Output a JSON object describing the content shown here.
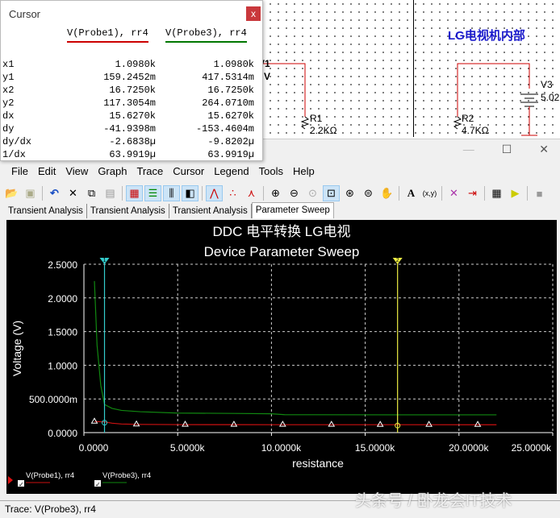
{
  "schematic": {
    "label_title": "LG电视机内部",
    "v1": "V1",
    "v1_val": "V",
    "r1": "R1",
    "r1_val": "2.2KΩ",
    "r2": "R2",
    "r2_val": "4.7KΩ",
    "v3": "V3",
    "v3_val": "5.02"
  },
  "cursor_window": {
    "title": "Cursor",
    "close": "x",
    "columns": [
      "V(Probe1), rr4",
      "V(Probe3), rr4"
    ],
    "col_colors": [
      "#cc0000",
      "#007700"
    ],
    "rows": [
      {
        "label": "x1",
        "v": [
          "1.0980k",
          "1.0980k"
        ]
      },
      {
        "label": "y1",
        "v": [
          "159.2452m",
          "417.5314m"
        ]
      },
      {
        "label": "x2",
        "v": [
          "16.7250k",
          "16.7250k"
        ]
      },
      {
        "label": "y2",
        "v": [
          "117.3054m",
          "264.0710m"
        ]
      },
      {
        "label": "dx",
        "v": [
          "15.6270k",
          "15.6270k"
        ]
      },
      {
        "label": "dy",
        "v": [
          "-41.9398m",
          "-153.4604m"
        ]
      },
      {
        "label": "dy/dx",
        "v": [
          "-2.6838µ",
          "-9.8202µ"
        ]
      },
      {
        "label": "1/dx",
        "v": [
          "63.9919µ",
          "63.9919µ"
        ]
      }
    ]
  },
  "grapher": {
    "menu": [
      "File",
      "Edit",
      "View",
      "Graph",
      "Trace",
      "Cursor",
      "Legend",
      "Tools",
      "Help"
    ],
    "tabs": [
      "Transient Analysis",
      "Transient Analysis",
      "Transient Analysis",
      "Parameter Sweep"
    ],
    "status": "Trace: V(Probe3), rr4",
    "watermark": "头条号 / 卧龙会IT技术"
  },
  "chart_data": {
    "type": "line",
    "title": "DDC 电平转换 LG电视",
    "subtitle": "Device Parameter Sweep",
    "xlabel": "resistance",
    "ylabel": "Voltage (V)",
    "xlim": [
      0,
      25000
    ],
    "ylim": [
      0,
      2.5
    ],
    "xticks": [
      "0.0000",
      "5.0000k",
      "10.0000k",
      "15.0000k",
      "20.0000k",
      "25.0000k"
    ],
    "yticks": [
      "0.0000",
      "500.0000m",
      "1.0000",
      "1.5000",
      "2.0000",
      "2.5000"
    ],
    "grid": true,
    "cursors": [
      {
        "label": "1",
        "x": 1098,
        "color": "#33cccc"
      },
      {
        "label": "2",
        "x": 16725,
        "color": "#eeee44"
      }
    ],
    "series": [
      {
        "name": "V(Probe1), rr4",
        "color": "#cc1111",
        "x": [
          560,
          1098,
          1500,
          2000,
          3000,
          5000,
          8000,
          10000,
          16725,
          22000
        ],
        "y": [
          0.165,
          0.159,
          0.14,
          0.128,
          0.122,
          0.119,
          0.118,
          0.1175,
          0.1173,
          0.117
        ]
      },
      {
        "name": "V(Probe3), rr4",
        "color": "#118811",
        "x": [
          560,
          700,
          900,
          1098,
          1500,
          2000,
          3000,
          5000,
          8000,
          10000,
          10700,
          16725,
          22000
        ],
        "y": [
          2.25,
          1.3,
          0.7,
          0.4175,
          0.36,
          0.33,
          0.31,
          0.29,
          0.285,
          0.28,
          0.266,
          0.264,
          0.264
        ]
      }
    ],
    "markers_x": [
      560,
      2800,
      5400,
      8000,
      10600,
      13200,
      15800,
      18400,
      21000
    ],
    "legend": "bottom-left"
  }
}
